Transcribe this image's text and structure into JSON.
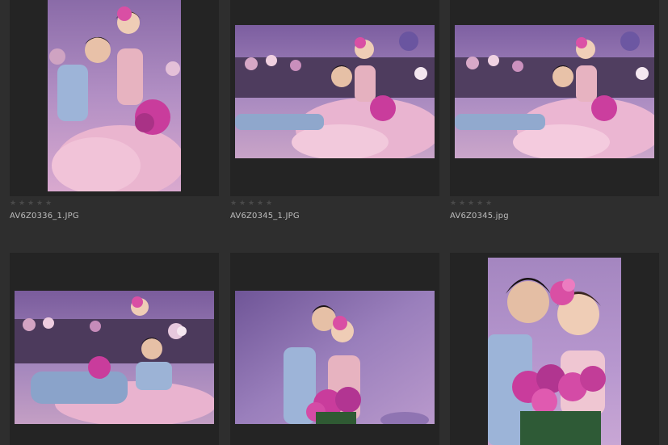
{
  "thumbnails": [
    {
      "filename": "AV6Z0336_1.JPG",
      "rating": 0,
      "orientation": "portrait"
    },
    {
      "filename": "AV6Z0345_1.JPG",
      "rating": 0,
      "orientation": "landscape"
    },
    {
      "filename": "AV6Z0345.jpg",
      "rating": 0,
      "orientation": "landscape"
    },
    {
      "filename": "",
      "rating": 0,
      "orientation": "landscape"
    },
    {
      "filename": "",
      "rating": 0,
      "orientation": "landscape"
    },
    {
      "filename": "",
      "rating": 0,
      "orientation": "portrait"
    }
  ],
  "colors": {
    "background": "#2e2e2e",
    "tile": "#242424",
    "star_empty": "#4a4a4a",
    "filename_text": "#bdbdbd"
  },
  "icons": {
    "rating_star": "empty-star-icon"
  }
}
